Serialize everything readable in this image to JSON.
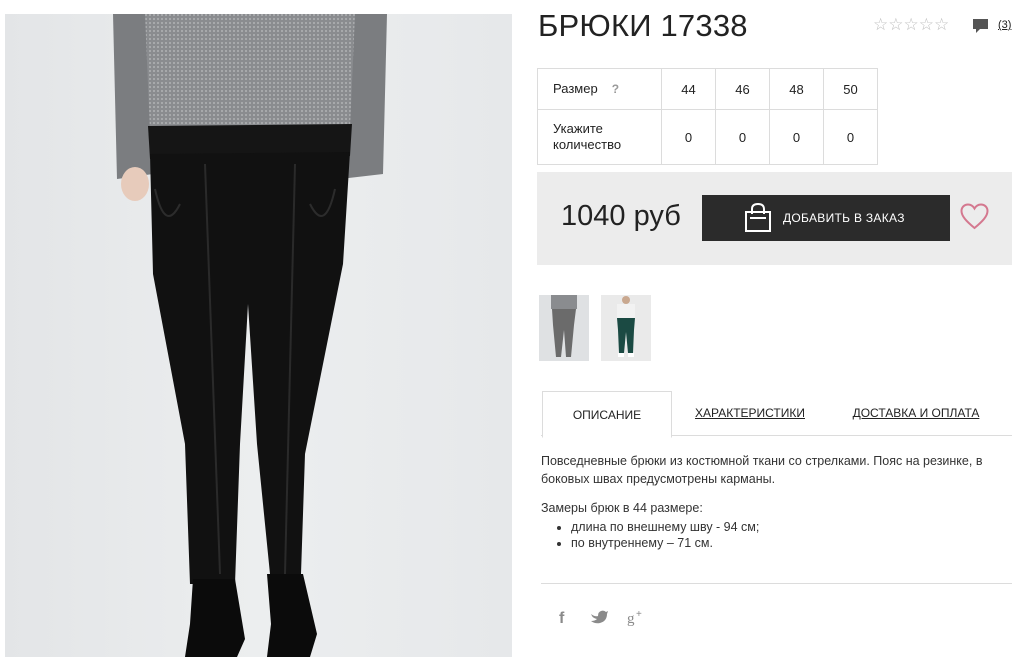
{
  "product": {
    "title": "БРЮКИ 17338",
    "rating_stars": "☆☆☆☆☆",
    "reviews_count": "(3)",
    "price": "1040 руб",
    "add_to_cart_label": "ДОБАВИТЬ В ЗАКАЗ"
  },
  "size_table": {
    "size_label": "Размер",
    "help_mark": "?",
    "quantity_label": "Укажите количество",
    "sizes": [
      "44",
      "46",
      "48",
      "50"
    ],
    "quantities": [
      "0",
      "0",
      "0",
      "0"
    ]
  },
  "tabs": [
    "ОПИСАНИЕ",
    "ХАРАКТЕРИСТИКИ",
    "ДОСТАВКА И ОПЛАТА"
  ],
  "description": {
    "text": "Повседневные брюки из костюмной ткани со стрелками. Пояс на резинке, в боковых швах предусмотрены карманы.",
    "measures_title": "Замеры брюк в 44 размере:",
    "measures": [
      "длина по внешнему шву - 94 см;",
      "по внутреннему – 71 см."
    ]
  },
  "social": [
    {
      "icon": "facebook-icon",
      "glyph": "f"
    },
    {
      "icon": "twitter-icon",
      "glyph": "🐦"
    },
    {
      "icon": "google-plus-icon",
      "glyph": "g+"
    }
  ],
  "colors": {
    "button_bg": "#2b2b2b",
    "buybox_bg": "#ececec",
    "heart": "#d4788f",
    "border": "#dcdcdc"
  }
}
